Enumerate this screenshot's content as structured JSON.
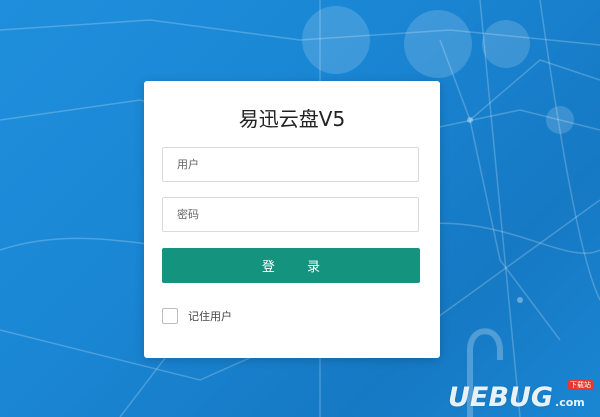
{
  "app": {
    "title": "易迅云盘V5"
  },
  "login_form": {
    "username": {
      "placeholder": "用户",
      "value": ""
    },
    "password": {
      "placeholder": "密码",
      "value": ""
    },
    "login_button_label": "登 录",
    "remember_label": "记住用户",
    "remember_checked": false
  },
  "watermark": {
    "text": "UEBUG",
    "suffix": ".com",
    "badge": "下载站"
  },
  "colors": {
    "background": "#1f8fdc",
    "card": "#ffffff",
    "button": "#14947f",
    "button_text": "#ffffff"
  }
}
